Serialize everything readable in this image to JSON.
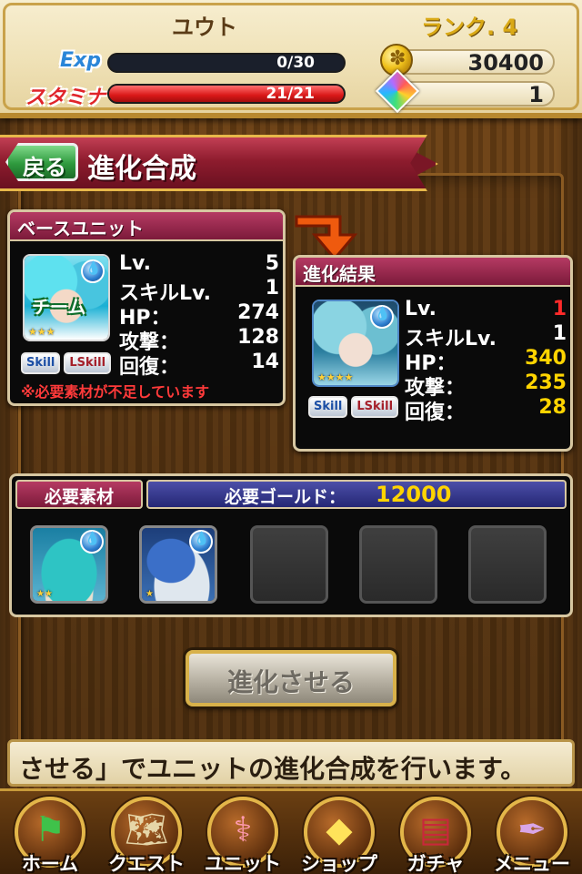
{
  "header": {
    "player_name": "ユウト",
    "rank": "ランク. 4",
    "exp_label": "Exp",
    "exp_text": "0/30",
    "exp_fraction": 0.0,
    "stamina_label": "スタミナ",
    "stamina_text": "21/21",
    "stamina_fraction": 1.0,
    "gold": "30400",
    "gems": "1"
  },
  "title_bar": {
    "back_label": "戻る",
    "title": "進化合成"
  },
  "base_unit": {
    "header": "ベースユニット",
    "team_tag": "チーム",
    "stars": "★★★",
    "skill_label": "Skill",
    "lskill_label": "LSkill",
    "stats": [
      {
        "label": "Lv.",
        "value": "5"
      },
      {
        "label": "スキルLv.",
        "value": "1"
      },
      {
        "label": "HP：",
        "value": "274"
      },
      {
        "label": "攻撃：",
        "value": "128"
      },
      {
        "label": "回復：",
        "value": "14"
      }
    ],
    "warning": "※必要素材が不足しています"
  },
  "result_unit": {
    "header": "進化結果",
    "stars": "★★★★",
    "skill_label": "Skill",
    "lskill_label": "LSkill",
    "stats": [
      {
        "label": "Lv.",
        "value": "1",
        "style": "red"
      },
      {
        "label": "スキルLv.",
        "value": "1",
        "style": "normal"
      },
      {
        "label": "HP：",
        "value": "340",
        "style": "up"
      },
      {
        "label": "攻撃：",
        "value": "235",
        "style": "up"
      },
      {
        "label": "回復：",
        "value": "28",
        "style": "up"
      }
    ]
  },
  "materials": {
    "header": "必要素材",
    "gold_label": "必要ゴールド：",
    "gold_value": "12000",
    "slot1_stars": "★★",
    "slot2_stars": "★"
  },
  "evolve_button": "進化させる",
  "ticker": "させる」でユニットの進化合成を行います。",
  "nav": [
    {
      "label": "ホーム",
      "icon": "flag-icon"
    },
    {
      "label": "クエスト",
      "icon": "map-icon"
    },
    {
      "label": "ユニット",
      "icon": "staff-icon"
    },
    {
      "label": "ショップ",
      "icon": "gem-icon"
    },
    {
      "label": "ガチャ",
      "icon": "book-icon"
    },
    {
      "label": "メニュー",
      "icon": "quill-icon"
    }
  ],
  "colors": {
    "accent_gold": "#ffd400",
    "ribbon_red": "#8e1c2e",
    "back_green": "#2f9a3e"
  }
}
